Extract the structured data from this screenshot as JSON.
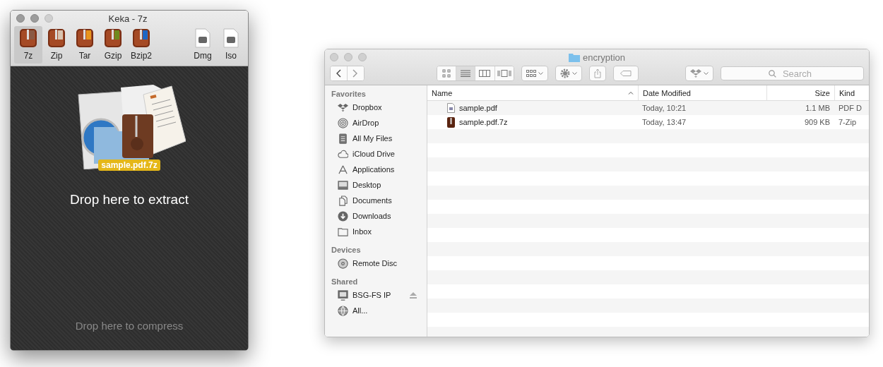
{
  "keka": {
    "title": "Keka - 7z",
    "formats": [
      {
        "label": "7z",
        "kind": "archive",
        "color": "#8a5a44",
        "selected": true
      },
      {
        "label": "Zip",
        "kind": "archive",
        "color": "#d9c4b0",
        "selected": false
      },
      {
        "label": "Tar",
        "kind": "archive",
        "color": "#e8951c",
        "selected": false
      },
      {
        "label": "Gzip",
        "kind": "archive",
        "color": "#6f8a1e",
        "selected": false
      },
      {
        "label": "Bzip2",
        "kind": "archive",
        "color": "#1d66c4",
        "selected": false
      },
      {
        "label": "Dmg",
        "kind": "disk",
        "selected": false
      },
      {
        "label": "Iso",
        "kind": "disk",
        "selected": false
      }
    ],
    "drag_label": "sample.pdf.7z",
    "extract_text": "Drop here to extract",
    "compress_text": "Drop here to compress"
  },
  "finder": {
    "title": "encryption",
    "search": {
      "placeholder": "Search"
    },
    "view_modes": [
      {
        "kind": "icons",
        "selected": false
      },
      {
        "kind": "list",
        "selected": true
      },
      {
        "kind": "columns",
        "selected": false
      },
      {
        "kind": "coverflow",
        "selected": false
      }
    ],
    "sidebar": [
      {
        "heading": "Favorites",
        "items": [
          {
            "label": "Dropbox",
            "kind": "dropbox"
          },
          {
            "label": "AirDrop",
            "kind": "airdrop"
          },
          {
            "label": "All My Files",
            "kind": "files"
          },
          {
            "label": "iCloud Drive",
            "kind": "cloud"
          },
          {
            "label": "Applications",
            "kind": "apps"
          },
          {
            "label": "Desktop",
            "kind": "desktop"
          },
          {
            "label": "Documents",
            "kind": "documents"
          },
          {
            "label": "Downloads",
            "kind": "downloads"
          },
          {
            "label": "Inbox",
            "kind": "folder"
          }
        ]
      },
      {
        "heading": "Devices",
        "items": [
          {
            "label": "Remote Disc",
            "kind": "disc"
          }
        ]
      },
      {
        "heading": "Shared",
        "items": [
          {
            "label": "BSG-FS IP",
            "kind": "server",
            "eject": true
          },
          {
            "label": "All...",
            "kind": "network"
          }
        ]
      }
    ],
    "columns": [
      {
        "label": "Name",
        "sorted": true
      },
      {
        "label": "Date Modified",
        "sorted": false
      },
      {
        "label": "Size",
        "sorted": false
      },
      {
        "label": "Kind",
        "sorted": false
      }
    ],
    "rows": [
      {
        "name": "sample.pdf",
        "kind": "pdf",
        "date": "Today, 10:21",
        "size": "1.1 MB",
        "type": "PDF D"
      },
      {
        "name": "sample.pdf.7z",
        "kind": "archive",
        "date": "Today, 13:47",
        "size": "909 KB",
        "type": "7-Zip"
      }
    ]
  }
}
